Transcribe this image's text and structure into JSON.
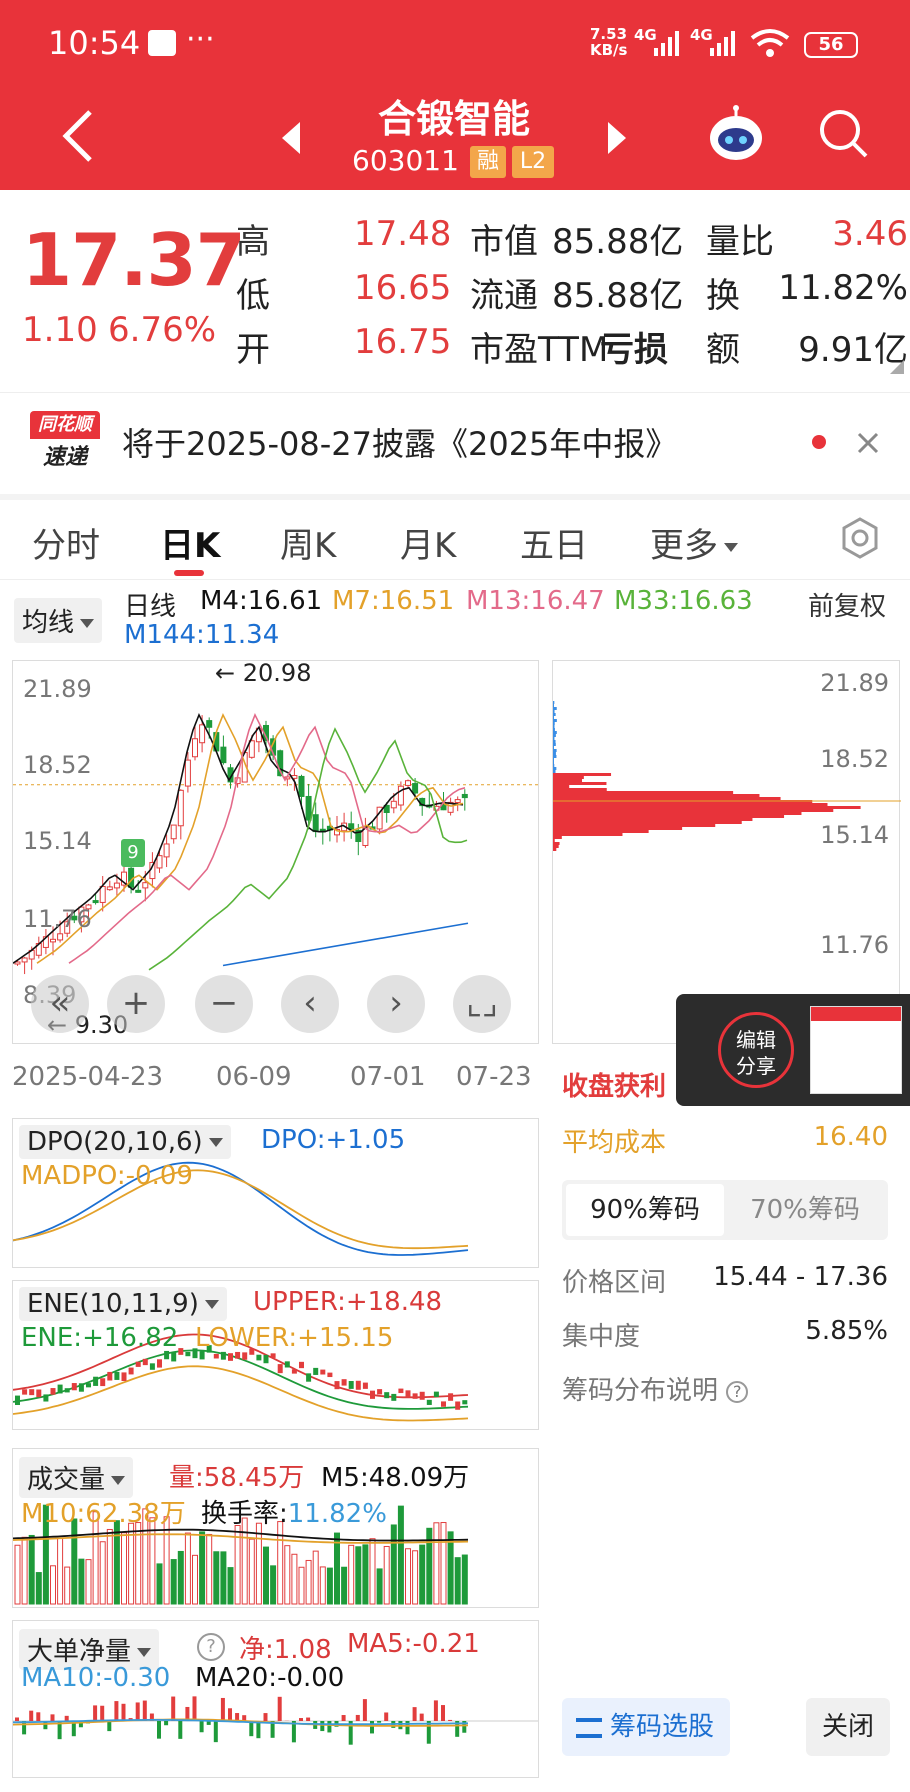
{
  "status": {
    "time": "10:54",
    "dots": "···",
    "net_speed_top": "7.53",
    "net_speed_unit": "KB/s",
    "net1": "4G",
    "net2": "4G",
    "battery": "56"
  },
  "header": {
    "name": "合锻智能",
    "code": "603011",
    "badge_rong": "融",
    "badge_l2": "L2"
  },
  "quote": {
    "price": "17.37",
    "change": "1.10",
    "change_pct": "6.76%",
    "stats": [
      {
        "label": "高",
        "value": "17.48",
        "label2": "市值",
        "value2": "85.88亿",
        "label3": "量比",
        "value3": "3.46"
      },
      {
        "label": "低",
        "value": "16.65",
        "label2": "流通",
        "value2": "85.88亿",
        "label3": "换",
        "value3": "11.82%"
      },
      {
        "label": "开",
        "value": "16.75",
        "label2": "市盈TTM",
        "value2": "亏损",
        "label3": "额",
        "value3": "9.91亿"
      }
    ]
  },
  "notice": {
    "logo_top": "同花顺",
    "logo_bottom": "速递",
    "text": "将于2025-08-27披露《2025年中报》"
  },
  "tabs": [
    {
      "label": "分时"
    },
    {
      "label": "日K"
    },
    {
      "label": "周K"
    },
    {
      "label": "月K"
    },
    {
      "label": "五日"
    },
    {
      "label": "更多"
    }
  ],
  "ma": {
    "selector": "均线",
    "period": "日线",
    "m4": "M4:16.61",
    "m7": "M7:16.51",
    "m13": "M13:16.47",
    "m33": "M33:16.63",
    "m144": "M144:11.34",
    "adjust": "前复权"
  },
  "kline": {
    "y_ticks": [
      "21.89",
      "18.52",
      "15.14",
      "11.76",
      "8.39"
    ],
    "high_mark": "20.98",
    "low_mark": "9.30",
    "dates": [
      "2025-04-23",
      "06-09",
      "07-01",
      "07-23"
    ],
    "badge": "9",
    "chart_data": {
      "type": "candlestick",
      "title": "合锻智能 日K",
      "ylim": [
        8.39,
        21.89
      ],
      "high": 20.98,
      "low": 9.3,
      "last_close": 17.37
    }
  },
  "chips": {
    "y_ticks": [
      "21.89",
      "18.52",
      "15.14",
      "11.76"
    ],
    "profit_label": "收盘获利",
    "avg_label": "平均成本",
    "avg_value": "16.40",
    "tab90": "90%筹码",
    "tab70": "70%筹码",
    "range_label": "价格区间",
    "range_value": "15.44 - 17.36",
    "conc_label": "集中度",
    "conc_value": "5.85%",
    "help": "筹码分布说明",
    "pick": "筹码选股",
    "close": "关闭"
  },
  "share": {
    "label": "编辑\n分享"
  },
  "dpo": {
    "selector": "DPO(20,10,6)",
    "dpo": "DPO:+1.05",
    "madpo": "MADPO:-0.09"
  },
  "ene": {
    "selector": "ENE(10,11,9)",
    "upper": "UPPER:+18.48",
    "ene": "ENE:+16.82",
    "lower": "LOWER:+15.15"
  },
  "vol": {
    "selector": "成交量",
    "vol": "量:58.45万",
    "m5": "M5:48.09万",
    "m10": "M10:62.38万",
    "turnover_label": "换手率:",
    "turnover": "11.82%"
  },
  "big": {
    "selector": "大单净量",
    "net": "净:1.08",
    "ma5": "MA5:-0.21",
    "ma10": "MA10:-0.30",
    "ma20": "MA20:-0.00"
  },
  "colors": {
    "red": "#e8333a",
    "up": "#e23d3d",
    "down": "#1e9a3a",
    "blue": "#1c6fd1",
    "orange": "#e3a12a",
    "pink": "#e36a8a"
  }
}
